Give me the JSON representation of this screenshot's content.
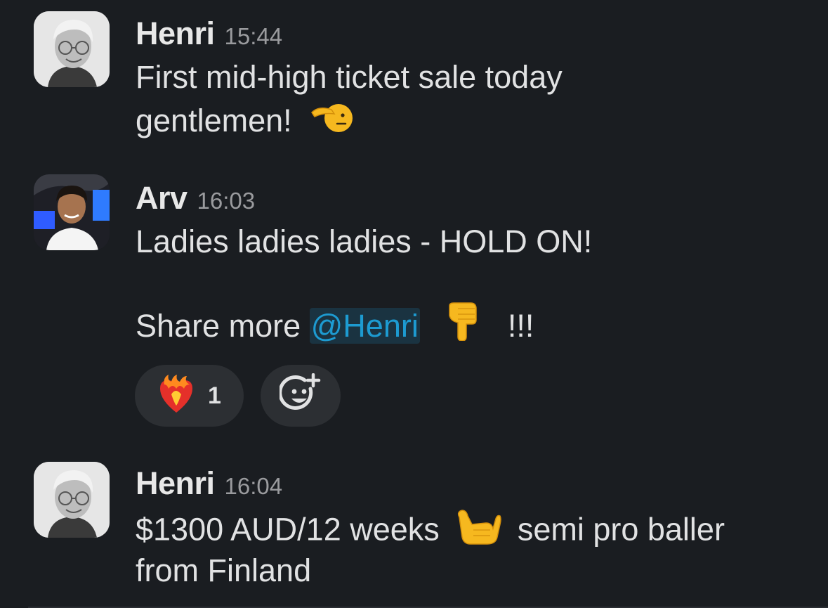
{
  "messages": [
    {
      "author": "Henri",
      "time": "15:44",
      "avatar": "henri-avatar",
      "lines": [
        "First mid-high ticket sale today",
        "gentlemen!"
      ],
      "emoji": "saluting-face-emoji"
    },
    {
      "author": "Arv",
      "time": "16:03",
      "avatar": "arv-avatar",
      "line1": "Ladies ladies ladies - HOLD ON!",
      "line2_prefix": "Share more",
      "mention": "@Henri",
      "emoji": "pointing-down-emoji",
      "line2_suffix": "!!!",
      "reactions": [
        {
          "emoji": "heart-on-fire-emoji",
          "count": "1"
        },
        {
          "emoji": "add-reaction-icon"
        }
      ]
    },
    {
      "author": "Henri",
      "time": "16:04",
      "avatar": "henri-avatar",
      "line1_prefix": "$1300 AUD/12 weeks",
      "emoji": "call-me-hand-emoji",
      "line1_suffix": "semi pro baller",
      "line2": "from Finland"
    }
  ],
  "colors": {
    "background": "#1a1d21",
    "text": "#e1e2e3",
    "timestamp": "#9a9b9e",
    "mention": "#1d9bd1",
    "reaction_bg": "#2c2f33"
  }
}
